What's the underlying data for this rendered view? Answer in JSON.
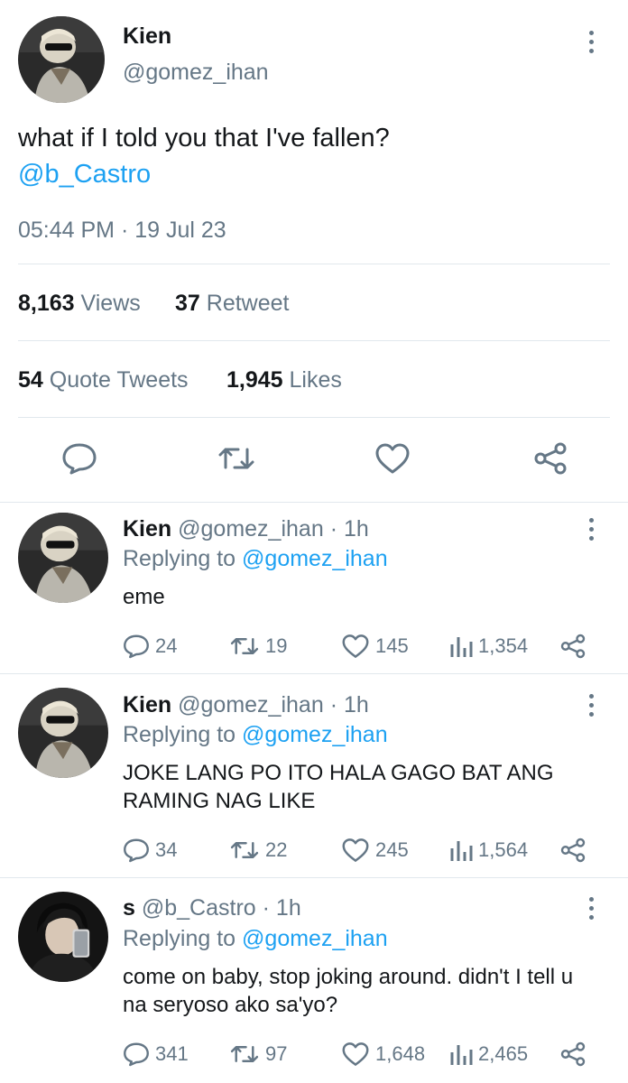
{
  "main_tweet": {
    "name": "Kien",
    "handle": "@gomez_ihan",
    "text": "what if I told you that I've fallen?",
    "mention": "@b_Castro",
    "timestamp": "05:44 PM · 19 Jul 23",
    "views_count": "8,163",
    "views_label": "Views",
    "retweet_count": "37",
    "retweet_label": "Retweet",
    "quote_count": "54",
    "quote_label": "Quote Tweets",
    "likes_count": "1,945",
    "likes_label": "Likes"
  },
  "replies": [
    {
      "name": "Kien",
      "handle": "@gomez_ihan",
      "time": "· 1h",
      "replying_prefix": "Replying to",
      "replying_to": "@gomez_ihan",
      "text": "eme",
      "replies": "24",
      "retweets": "19",
      "likes": "145",
      "views": "1,354"
    },
    {
      "name": "Kien",
      "handle": "@gomez_ihan",
      "time": "· 1h",
      "replying_prefix": "Replying to",
      "replying_to": "@gomez_ihan",
      "text": "JOKE LANG PO ITO HALA GAGO BAT ANG RAMING NAG LIKE",
      "replies": "34",
      "retweets": "22",
      "likes": "245",
      "views": "1,564"
    },
    {
      "name": "s",
      "handle": "@b_Castro",
      "time": "· 1h",
      "replying_prefix": "Replying to",
      "replying_to": "@gomez_ihan",
      "text": "come on baby, stop joking around. didn't I tell u na seryoso ako sa'yo?",
      "replies": "341",
      "retweets": "97",
      "likes": "1,648",
      "views": "2,465"
    }
  ],
  "icons": {
    "reply": "speech-bubble",
    "retweet": "retweet-arrows",
    "like": "heart",
    "views": "bar-chart",
    "share": "share-nodes",
    "more": "vertical-ellipsis"
  },
  "colors": {
    "accent": "#1da1f2",
    "text": "#14171a",
    "secondary": "#657786",
    "divider": "#e1e8ed"
  }
}
